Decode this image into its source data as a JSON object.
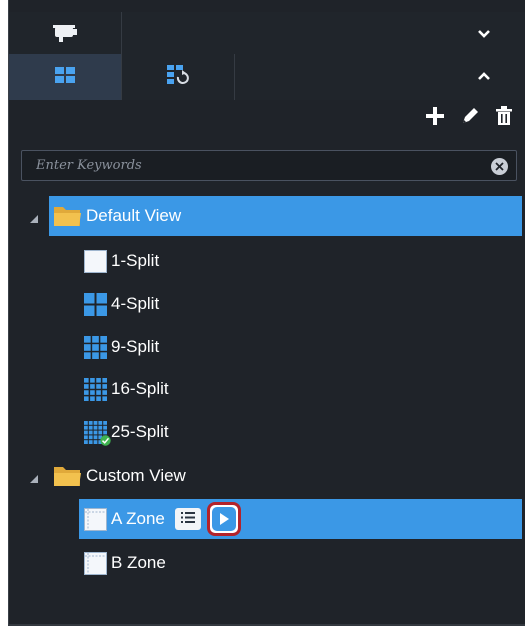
{
  "top_tabs": [
    {
      "name": "camera",
      "icon": "camera-icon"
    }
  ],
  "view_tabs": [
    {
      "name": "view",
      "icon": "grid-view-icon",
      "active": true
    },
    {
      "name": "tour",
      "icon": "view-tour-icon",
      "active": false
    }
  ],
  "toolbar": {
    "icons": [
      "add-icon",
      "edit-icon",
      "delete-icon"
    ]
  },
  "search": {
    "placeholder": "Enter Keywords",
    "value": ""
  },
  "tree": {
    "default_view": {
      "label": "Default View",
      "expanded": true,
      "selected": true,
      "children": [
        {
          "label": "1-Split",
          "icon": "split-1-icon"
        },
        {
          "label": "4-Split",
          "icon": "split-4-icon"
        },
        {
          "label": "9-Split",
          "icon": "split-9-icon"
        },
        {
          "label": "16-Split",
          "icon": "split-16-icon"
        },
        {
          "label": "25-Split",
          "icon": "split-25-icon",
          "badge": "check"
        }
      ]
    },
    "custom_view": {
      "label": "Custom View",
      "expanded": true,
      "children": [
        {
          "label": "A Zone",
          "icon": "custom-zone-icon",
          "selected": true,
          "actions": [
            "list-icon",
            "play-icon"
          ]
        },
        {
          "label": "B Zone",
          "icon": "custom-zone-icon"
        }
      ]
    }
  },
  "colors": {
    "background": "#1f2329",
    "selection": "#3b98e6",
    "highlight_border": "#b3232b",
    "folder": "#f2c14e"
  }
}
